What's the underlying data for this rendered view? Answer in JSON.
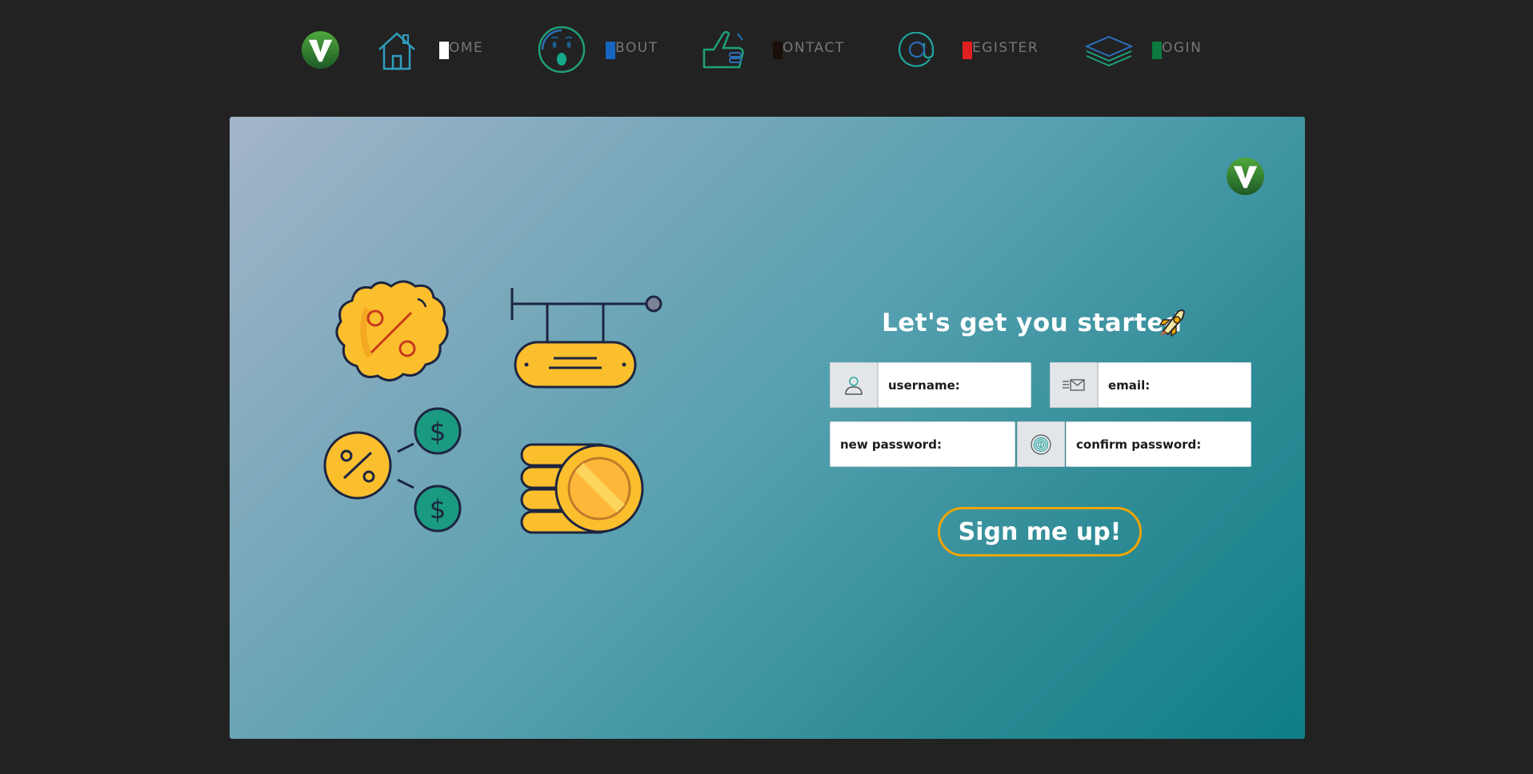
{
  "nav": {
    "items": [
      {
        "label": "OME",
        "mark_color": "#ffffff",
        "icon": "house-icon"
      },
      {
        "label": "BOUT",
        "mark_color": "#1565c0",
        "icon": "surprised-face-icon"
      },
      {
        "label": "ONTACT",
        "mark_color": "#1a0f0a",
        "icon": "call-me-hand-icon"
      },
      {
        "label": "EGISTER",
        "mark_color": "#e02020",
        "icon": "at-sign-icon"
      },
      {
        "label": "OGIN",
        "mark_color": "#0a7a3e",
        "icon": "layers-icon"
      }
    ]
  },
  "form": {
    "title": "Let's get you started",
    "fields": {
      "username": {
        "placeholder": "username:",
        "value": ""
      },
      "email": {
        "placeholder": "email:",
        "value": ""
      },
      "new_password": {
        "placeholder": "new password:",
        "value": ""
      },
      "confirm_password": {
        "placeholder": "confirm password:",
        "value": ""
      }
    },
    "submit_label": "Sign me up!"
  },
  "colors": {
    "page_bg": "#222222",
    "accent_yellow": "#f0a500",
    "card_gradient_start": "#a3b5c8",
    "card_gradient_end": "#0f7e86"
  }
}
